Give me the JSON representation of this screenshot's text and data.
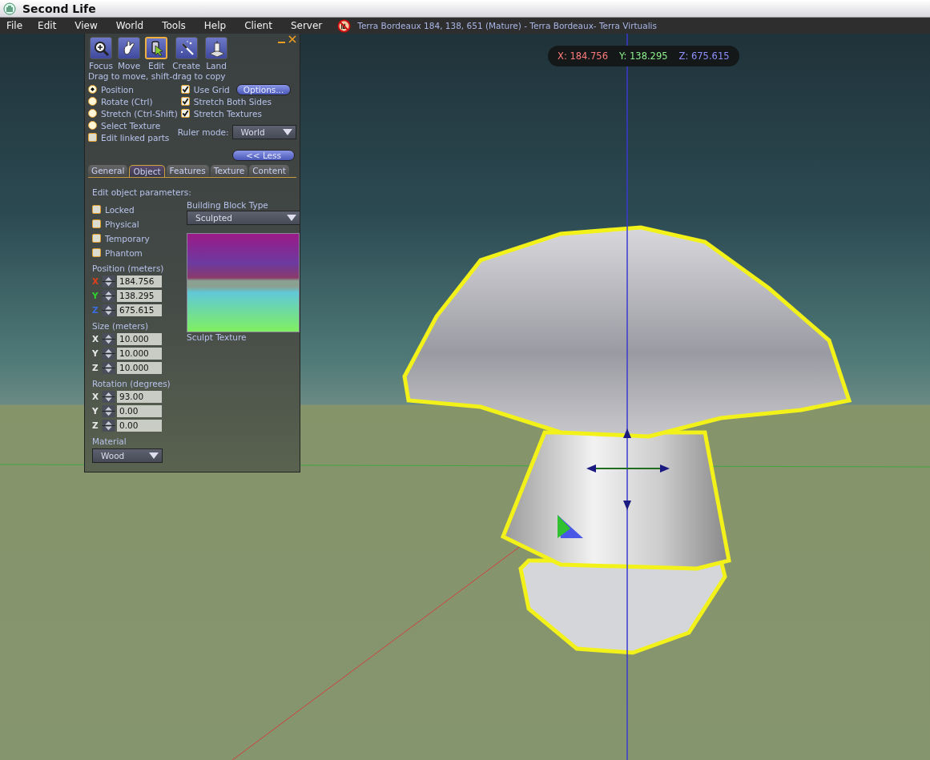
{
  "window": {
    "title": "Second Life"
  },
  "menu": [
    "File",
    "Edit",
    "View",
    "World",
    "Tools",
    "Help",
    "Client",
    "Server"
  ],
  "region_info": "Terra Bordeaux 184, 138, 651 (Mature) - Terra Bordeaux- Terra Virtualis",
  "coordinates": [
    {
      "text": "X: 184.756",
      "color": "#ff7b7b"
    },
    {
      "text": "Y: 138.295",
      "color": "#8cf08c"
    },
    {
      "text": "Z: 675.615",
      "color": "#8f8fff"
    }
  ],
  "tool_panel": {
    "tools": [
      {
        "label": "Focus",
        "kind": "focus",
        "selected": false
      },
      {
        "label": "Move",
        "kind": "move",
        "selected": false
      },
      {
        "label": "Edit",
        "kind": "edit",
        "selected": true
      },
      {
        "label": "Create",
        "kind": "create",
        "selected": false
      },
      {
        "label": "Land",
        "kind": "land",
        "selected": false
      }
    ],
    "hint": "Drag to move, shift-drag to copy",
    "modes": [
      {
        "label": "Position",
        "selected": true
      },
      {
        "label": "Rotate (Ctrl)",
        "selected": false
      },
      {
        "label": "Stretch (Ctrl-Shift)",
        "selected": false
      },
      {
        "label": "Select Texture",
        "selected": false
      }
    ],
    "edit_linked_parts": {
      "label": "Edit linked parts",
      "checked": false
    },
    "grid_options": [
      {
        "label": "Use Grid",
        "checked": true
      },
      {
        "label": "Stretch Both Sides",
        "checked": true
      },
      {
        "label": "Stretch Textures",
        "checked": true
      }
    ],
    "options_button": "Options...",
    "ruler_mode": {
      "label": "Ruler mode:",
      "value": "World"
    },
    "less_button": "<< Less",
    "tabs": [
      {
        "label": "General",
        "selected": false
      },
      {
        "label": "Object",
        "selected": true
      },
      {
        "label": "Features",
        "selected": false
      },
      {
        "label": "Texture",
        "selected": false
      },
      {
        "label": "Content",
        "selected": false
      }
    ],
    "object": {
      "heading": "Edit object parameters:",
      "flags": [
        {
          "label": "Locked",
          "checked": false
        },
        {
          "label": "Physical",
          "checked": false
        },
        {
          "label": "Temporary",
          "checked": false
        },
        {
          "label": "Phantom",
          "checked": false
        }
      ],
      "groups": [
        {
          "title": "Position (meters)",
          "fields": [
            {
              "axis": "X",
              "value": "184.756",
              "color": "#e0401a"
            },
            {
              "axis": "Y",
              "value": "138.295",
              "color": "#30d030"
            },
            {
              "axis": "Z",
              "value": "675.615",
              "color": "#3a6ee0"
            }
          ]
        },
        {
          "title": "Size (meters)",
          "fields": [
            {
              "axis": "X",
              "value": "10.000"
            },
            {
              "axis": "Y",
              "value": "10.000"
            },
            {
              "axis": "Z",
              "value": "10.000"
            }
          ]
        },
        {
          "title": "Rotation (degrees)",
          "fields": [
            {
              "axis": "X",
              "value": "93.00"
            },
            {
              "axis": "Y",
              "value": "0.00"
            },
            {
              "axis": "Z",
              "value": "0.00"
            }
          ]
        }
      ],
      "material": {
        "label": "Material",
        "value": "Wood"
      },
      "block_type": {
        "label": "Building Block Type",
        "value": "Sculpted"
      },
      "sculpt_texture_label": "Sculpt Texture"
    }
  }
}
